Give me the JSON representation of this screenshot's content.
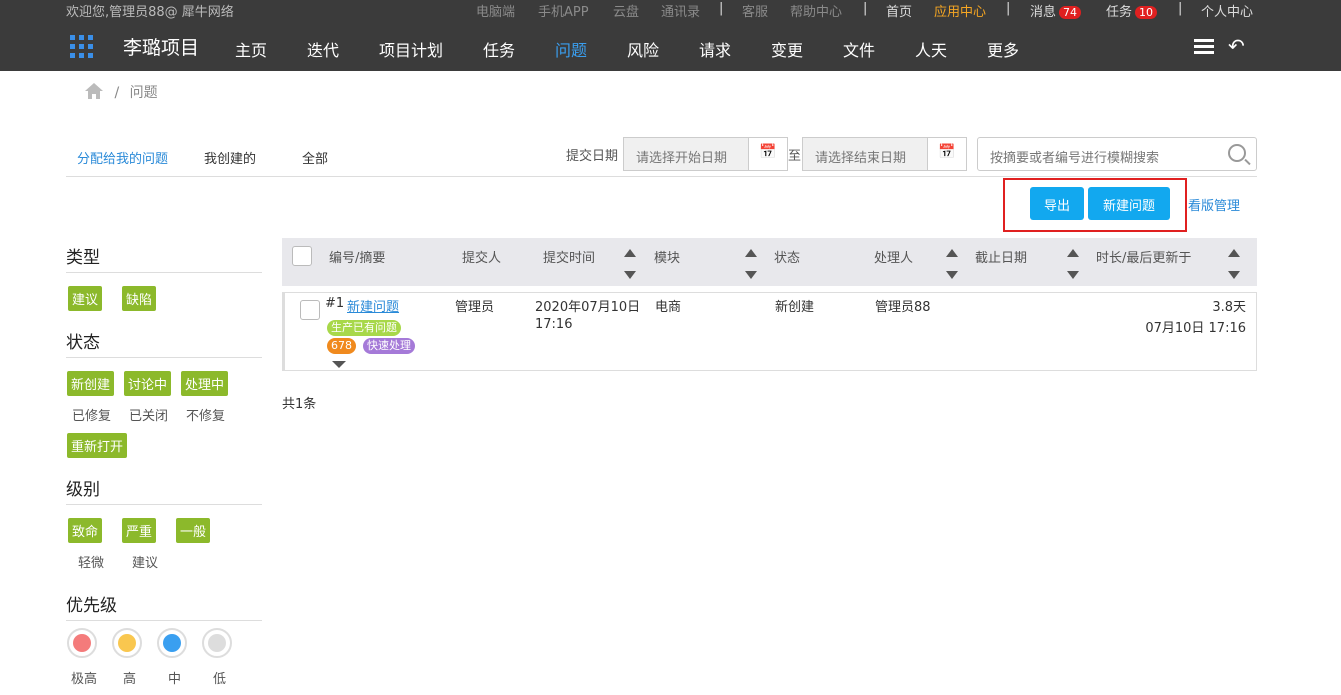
{
  "topbar": {
    "welcome": "欢迎您,管理员88@ 犀牛网络",
    "links": [
      "电脑端",
      "手机APP",
      "云盘",
      "通讯录",
      "客服",
      "帮助中心",
      "首页",
      "应用中心",
      "消息",
      "任务",
      "个人中心"
    ],
    "messages_count": "74",
    "tasks_count": "10"
  },
  "nav": {
    "project": "李璐项目",
    "items": [
      "主页",
      "迭代",
      "项目计划",
      "任务",
      "问题",
      "风险",
      "请求",
      "变更",
      "文件",
      "人天",
      "更多"
    ],
    "active": "问题"
  },
  "breadcrumb": {
    "current": "问题",
    "sep": "/"
  },
  "tabs": [
    "分配给我的问题",
    "我创建的",
    "全部"
  ],
  "filters": {
    "date_label": "提交日期",
    "start_placeholder": "请选择开始日期",
    "to_label": "至",
    "end_placeholder": "请选择结束日期",
    "search_placeholder": "按摘要或者编号进行模糊搜索"
  },
  "actions": {
    "export": "导出",
    "new_issue": "新建问题",
    "kanban": "看版管理"
  },
  "sidebar": {
    "type": {
      "title": "类型",
      "chips": [
        "建议",
        "缺陷"
      ]
    },
    "status": {
      "title": "状态",
      "chips": [
        "新创建",
        "讨论中",
        "处理中"
      ],
      "plain": [
        "已修复",
        "已关闭",
        "不修复"
      ],
      "chip2": "重新打开"
    },
    "level": {
      "title": "级别",
      "chips": [
        "致命",
        "严重",
        "一般"
      ],
      "plain": [
        "轻微",
        "建议"
      ]
    },
    "priority": {
      "title": "优先级",
      "labels": [
        "极高",
        "高",
        "中",
        "低"
      ],
      "colors": [
        "#f47b7b",
        "#f9c74f",
        "#3a9ff0",
        "#dddddd"
      ]
    }
  },
  "table": {
    "headers": [
      "编号/摘要",
      "提交人",
      "提交时间",
      "模块",
      "状态",
      "处理人",
      "截止日期",
      "时长/最后更新于"
    ],
    "rows": [
      {
        "id": "#1",
        "title": "新建问题",
        "tags": [
          "生产已有问题",
          "678",
          "快速处理"
        ],
        "tag_colors": [
          "#a8d84a",
          "#f08a1e",
          "#a57ad8"
        ],
        "submitter": "管理员",
        "time_date": "2020年07月10日",
        "time_clock": "17:16",
        "module": "电商",
        "status": "新创建",
        "assignee": "管理员88",
        "deadline": "",
        "duration": "3.8天",
        "updated": "07月10日 17:16"
      }
    ],
    "total": "共1条"
  }
}
